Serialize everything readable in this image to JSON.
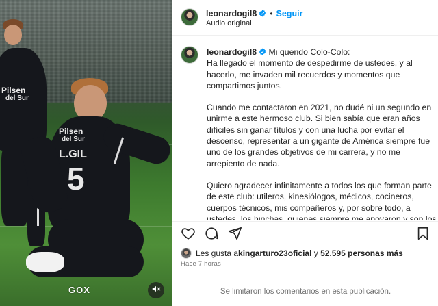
{
  "media": {
    "watermark": "GOX",
    "shirt_sponsor_line1": "Pilsen",
    "shirt_sponsor_line2": "del Sur",
    "shirt_name": "L.GIL",
    "shirt_number": "5",
    "mute_icon": "speaker-muted-icon"
  },
  "post_header": {
    "username": "leonardogil8",
    "separator": "•",
    "follow_label": "Seguir",
    "audio_label": "Audio original"
  },
  "caption": {
    "username": "leonardogil8",
    "paragraphs": [
      "Mi querido Colo-Colo:\nHa llegado el momento de despedirme de ustedes, y al hacerlo, me invaden mil recuerdos y momentos que compartimos juntos.",
      "Cuando me contactaron en 2021, no dudé ni un segundo en unirme a este hermoso club. Si bien sabía que eran años difíciles sin ganar títulos y con una lucha por evitar el descenso, representar a un gigante de América siempre fue uno de los grandes objetivos de mi carrera, y no me arrepiento de nada.",
      "Quiero agradecer infinitamente a todos los que forman parte de este club: utileros, kinesiólogos, médicos, cocineros, cuerpos técnicos, mis compañeros y, por sobre todo, a ustedes, los hinchas, quienes siempre me apoyaron y son los que realmente hacen grande a Colo-Colo. Porque este club es grande gracias a su gente, y ese apoyo es algo que llevaré"
    ]
  },
  "actions": {
    "like_icon": "heart-icon",
    "comment_icon": "comment-icon",
    "share_icon": "share-icon",
    "save_icon": "bookmark-icon"
  },
  "likes": {
    "prefix": "Les gusta a ",
    "liker": "kingarturo23oficial",
    "middle": " y ",
    "count": "52.595 personas más"
  },
  "timestamp": "Hace 7 horas",
  "comments_notice": "Se limitaron los comentarios en esta publicación.",
  "colors": {
    "accent": "#0095f6",
    "text": "#262626",
    "secondary": "#737373",
    "divider": "#efefef"
  }
}
